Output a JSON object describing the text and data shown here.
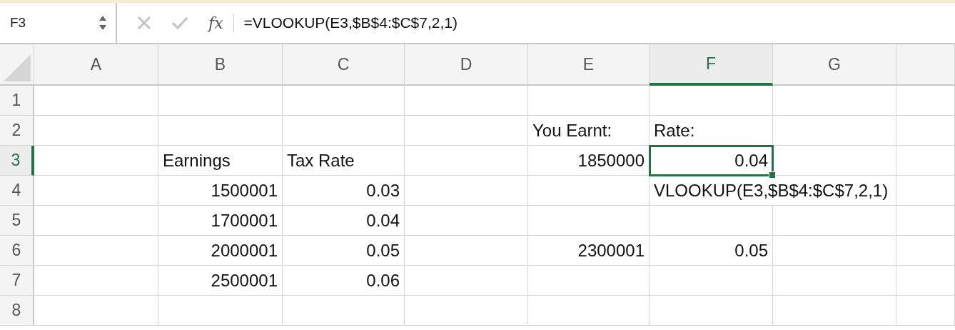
{
  "formula_bar": {
    "name_box": "F3",
    "function_label": "fx",
    "formula": "=VLOOKUP(E3,$B$4:$C$7,2,1)"
  },
  "columns": [
    {
      "label": "A",
      "selected": false
    },
    {
      "label": "B",
      "selected": false
    },
    {
      "label": "C",
      "selected": false
    },
    {
      "label": "D",
      "selected": false
    },
    {
      "label": "E",
      "selected": false
    },
    {
      "label": "F",
      "selected": true
    },
    {
      "label": "G",
      "selected": false
    },
    {
      "selected": false
    }
  ],
  "rows": [
    {
      "label": "1",
      "selected": false,
      "cells": [
        {},
        {},
        {},
        {},
        {},
        {},
        {},
        {}
      ]
    },
    {
      "label": "2",
      "selected": false,
      "cells": [
        {},
        {},
        {},
        {},
        {
          "text": "You Earnt:",
          "kind": "text"
        },
        {
          "text": "Rate:",
          "kind": "text"
        },
        {},
        {}
      ]
    },
    {
      "label": "3",
      "selected": true,
      "cells": [
        {},
        {
          "text": "Earnings",
          "kind": "text"
        },
        {
          "text": "Tax Rate",
          "kind": "text"
        },
        {},
        {
          "text": "1850000",
          "kind": "number"
        },
        {
          "text": "0.04",
          "kind": "number",
          "selected": true
        },
        {},
        {}
      ]
    },
    {
      "label": "4",
      "selected": false,
      "cells": [
        {},
        {
          "text": "1500001",
          "kind": "number"
        },
        {
          "text": "0.03",
          "kind": "number"
        },
        {},
        {},
        {
          "text": "VLOOKUP(E3,$B$4:$C$7,2,1)",
          "kind": "text"
        },
        {},
        {}
      ]
    },
    {
      "label": "5",
      "selected": false,
      "cells": [
        {},
        {
          "text": "1700001",
          "kind": "number"
        },
        {
          "text": "0.04",
          "kind": "number"
        },
        {},
        {},
        {},
        {},
        {}
      ]
    },
    {
      "label": "6",
      "selected": false,
      "cells": [
        {},
        {
          "text": "2000001",
          "kind": "number"
        },
        {
          "text": "0.05",
          "kind": "number"
        },
        {},
        {
          "text": "2300001",
          "kind": "number"
        },
        {
          "text": "0.05",
          "kind": "number"
        },
        {},
        {}
      ]
    },
    {
      "label": "7",
      "selected": false,
      "cells": [
        {},
        {
          "text": "2500001",
          "kind": "number"
        },
        {
          "text": "0.06",
          "kind": "number"
        },
        {},
        {},
        {},
        {},
        {}
      ]
    },
    {
      "label": "8",
      "selected": false,
      "cells": [
        {},
        {},
        {},
        {},
        {},
        {},
        {},
        {}
      ]
    }
  ]
}
